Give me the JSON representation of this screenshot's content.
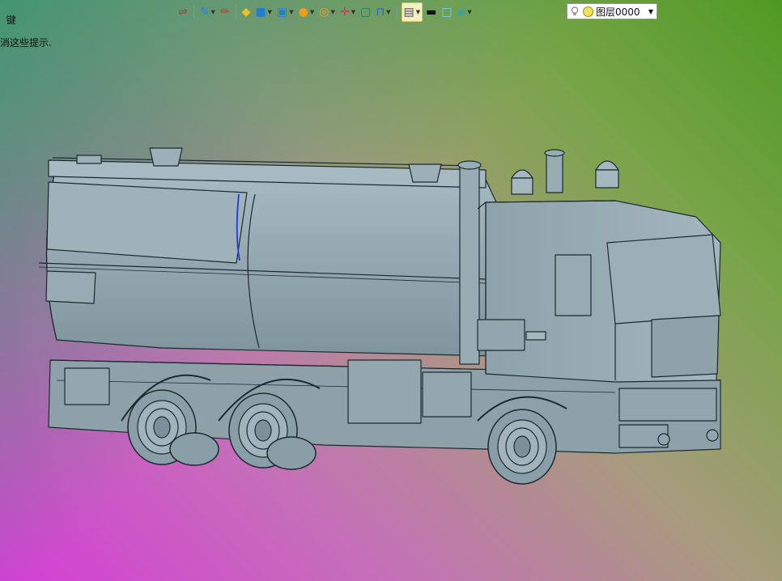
{
  "hint": {
    "line1": "键",
    "line2": "消这些提示."
  },
  "toolbar": {
    "items": [
      {
        "name": "sketch-tool-icon",
        "glyph": "⇌",
        "color": "#c0392b"
      },
      {
        "name": "pen-tool-icon",
        "glyph": "✎",
        "color": "#2a7fd4"
      },
      {
        "name": "pencil-icon",
        "glyph": "✏",
        "color": "#c0392b"
      },
      {
        "name": "sheet-icon",
        "glyph": "◆",
        "color": "#f2c21b"
      },
      {
        "name": "solid-cube-icon",
        "glyph": "■",
        "color": "#1f7fd0"
      },
      {
        "name": "shaded-box-icon",
        "glyph": "▣",
        "color": "#1f7fd0"
      },
      {
        "name": "sphere-icon",
        "glyph": "●",
        "color": "#f09b1c"
      },
      {
        "name": "zoom-view-icon",
        "glyph": "◎",
        "color": "#f09b1c"
      },
      {
        "name": "axis-icon",
        "glyph": "✛",
        "color": "#d1344b"
      },
      {
        "name": "frame-icon",
        "glyph": "▢",
        "color": "#1f7f5a"
      },
      {
        "name": "section-icon",
        "glyph": "⊓",
        "color": "#2469b7"
      },
      {
        "name": "display-mode-icon",
        "glyph": "▤",
        "color": "#4a4a4a"
      },
      {
        "name": "line-color-icon",
        "glyph": "▬",
        "color": "#111111"
      },
      {
        "name": "fill-color-icon",
        "glyph": "□",
        "color": "#7ad2f2"
      },
      {
        "name": "material-icon",
        "glyph": "◈",
        "color": "#2aa7b5"
      }
    ]
  },
  "layer": {
    "name": "图层0000"
  },
  "colors": {
    "body": "#8fa3ad",
    "edge": "#1c2a30",
    "highlight": "#1f3bd6"
  }
}
